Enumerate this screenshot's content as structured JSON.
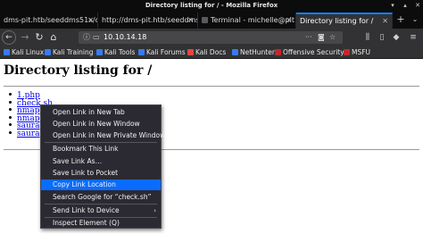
{
  "window": {
    "title": "Directory listing for / - Mozilla Firefox"
  },
  "tabs": [
    {
      "label": "dms-pit.htb/seeddms51x/da"
    },
    {
      "label": "http://dms-pit.htb/seeddms"
    },
    {
      "label": "Terminal - michelle@pit"
    },
    {
      "label": "Directory listing for /"
    }
  ],
  "navbar": {
    "url": "10.10.14.18"
  },
  "bookmarks": [
    {
      "label": "Kali Linux",
      "color": "#367bf0"
    },
    {
      "label": "Kali Training",
      "color": "#367bf0"
    },
    {
      "label": "Kali Tools",
      "color": "#367bf0"
    },
    {
      "label": "Kali Forums",
      "color": "#367bf0"
    },
    {
      "label": "Kali Docs",
      "color": "#e0483e"
    },
    {
      "label": "NetHunter",
      "color": "#367bf0"
    },
    {
      "label": "Offensive Security",
      "color": "#c1272d"
    },
    {
      "label": "MSFU",
      "color": "#c1272d"
    }
  ],
  "page": {
    "heading": "Directory listing for /",
    "files": [
      "1.php",
      "check.sh",
      "nmap",
      "nmap",
      "saura",
      "saura"
    ]
  },
  "context_menu": {
    "items": [
      {
        "label": "Open Link in New Tab"
      },
      {
        "label": "Open Link in New Window"
      },
      {
        "label": "Open Link in New Private Window"
      },
      {
        "label": "Bookmark This Link"
      },
      {
        "label": "Save Link As…"
      },
      {
        "label": "Save Link to Pocket"
      },
      {
        "label": "Copy Link Location"
      },
      {
        "label": "Search Google for “check.sh”"
      },
      {
        "label": "Send Link to Device"
      },
      {
        "label": "Inspect Element (Q)"
      }
    ]
  }
}
